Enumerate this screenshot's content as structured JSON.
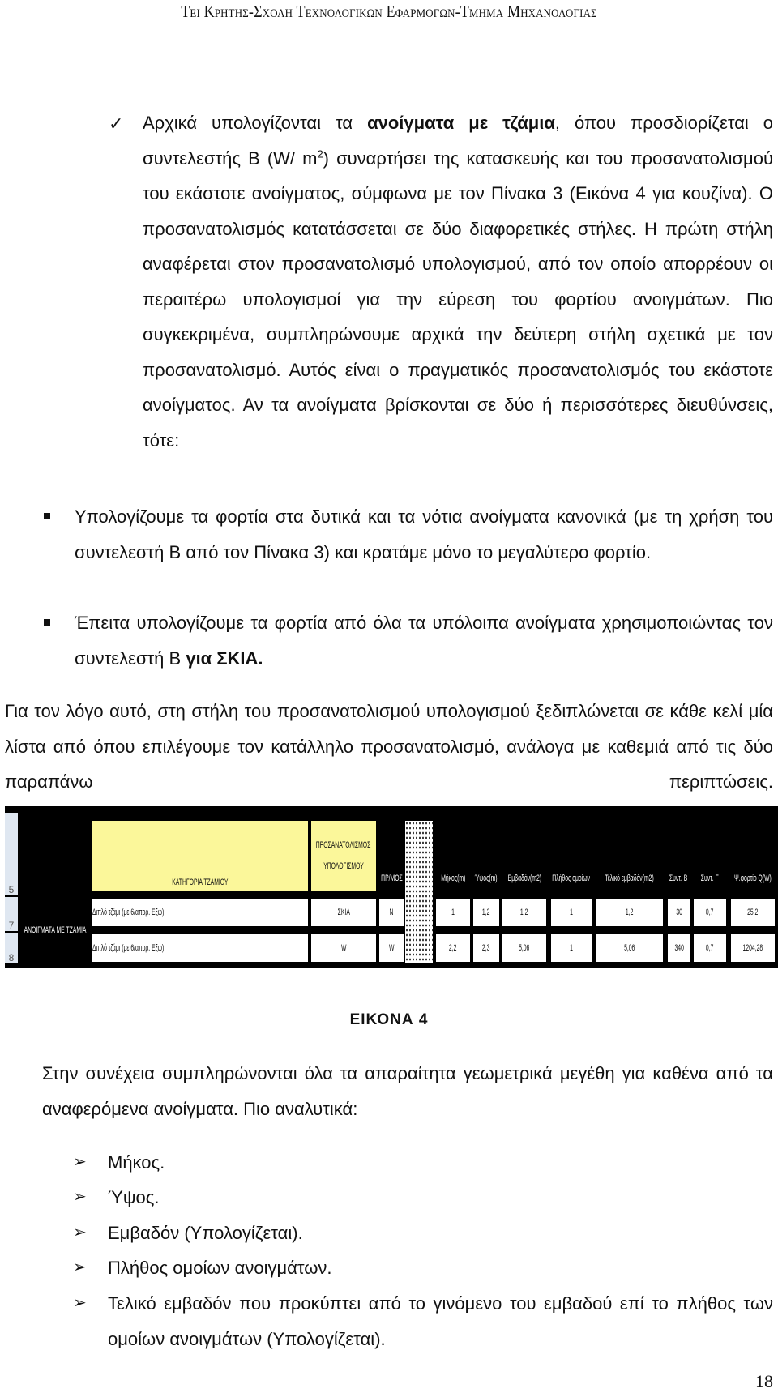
{
  "header": {
    "title": "Τει Κρητης-Σχολη Τεχνολογικων Εφαρμογων-Τμημα Μηχανολογιας"
  },
  "check_item": {
    "icon": "check-icon",
    "lead": "Αρχικά υπολογίζονται τα ",
    "bold": "ανοίγματα με τζάμια",
    "rest1": ", όπου προσδιορίζεται ο συντελεστής Β (W/ m",
    "sup": "2",
    "rest2": ") συναρτήσει της κατασκευής και του προσανατολισμού του εκάστοτε ανοίγματος, σύμφωνα με τον Πίνακα 3 (Εικόνα 4 για κουζίνα). Ο προσανατολισμός κατατάσσεται σε δύο διαφορετικές στήλες. Η πρώτη στήλη αναφέρεται στον προσανατολισμό υπολογισμού, από τον οποίο απορρέουν οι περαιτέρω υπολογισμοί για την εύρεση του φορτίου ανοιγμάτων. Πιο συγκεκριμένα, συμπληρώνουμε αρχικά την δεύτερη στήλη σχετικά με τον προσανατολισμό. Αυτός είναι ο πραγματικός προσανατολισμός του εκάστοτε ανοίγματος. Αν τα ανοίγματα βρίσκονται σε δύο ή περισσότερες διευθύνσεις, τότε:"
  },
  "square_items": [
    {
      "icon": "square-bullet-icon",
      "text": "Υπολογίζουμε τα φορτία στα δυτικά και τα νότια ανοίγματα κανονικά (με τη χρήση του συντελεστή Β από τον Πίνακα 3) και κρατάμε μόνο το μεγαλύτερο φορτίο."
    },
    {
      "icon": "square-bullet-icon",
      "text": "Έπειτα υπολογίζουμε τα φορτία από όλα τα υπόλοιπα ανοίγματα χρησιμοποιώντας τον συντελεστή Β ",
      "bold": "για ΣΚΙΑ."
    }
  ],
  "paragraph1": "Για τον λόγο αυτό, στη στήλη του προσανατολισμού υπολογισμού ξεδιπλώνεται σε κάθε κελί μία λίστα από όπου επιλέγουμε τον κατάλληλο προσανατολισμό, ανάλογα με καθεμιά από τις δύο παραπάνω περιπτώσεις.",
  "figure": {
    "row_numbers": [
      "5",
      "7",
      "8"
    ],
    "group_label": "ΑΝΟΙΓΜΑΤΑ ΜΕ ΤΖΑΜΙΑ",
    "headers": {
      "category": "ΚΑΤΗΓΟΡΙΑ ΤΖΑΜΙΟΥ",
      "calc_orientation_1": "ΠΡΟΣΑΝΑΤΟΛΙΣΜΟΣ",
      "calc_orientation_2": "ΥΠΟΛΟΓΙΣΜΟΥ",
      "orientation": "ΠΡ/ΜΟΣ",
      "length": "Μήκος(m)",
      "height": "Ύψος(m)",
      "area": "Εμβαδόν(m2)",
      "count": "Πλήθος ομοίων",
      "final_area": "Τελικό εμβαδόν(m2)",
      "coef_b": "Συντ. Β",
      "coef_f": "Συντ. F",
      "load": "Ψ.φορτίο Q(W)"
    },
    "rows": [
      {
        "category": "Διπλό τζάμι (με 6/απορ. Εξω)",
        "calc_orientation": "ΣΚΙΑ",
        "orientation": "N",
        "length": "1",
        "height": "1,2",
        "area": "1,2",
        "count": "1",
        "final_area": "1,2",
        "coef_b": "30",
        "coef_f": "0,7",
        "load": "25,2"
      },
      {
        "category": "Διπλό τζάμι (με 6/απορ. Εξω)",
        "calc_orientation": "W",
        "orientation": "W",
        "length": "2,2",
        "height": "2,3",
        "area": "5,06",
        "count": "1",
        "final_area": "5,06",
        "coef_b": "340",
        "coef_f": "0,7",
        "load": "1204,28"
      }
    ]
  },
  "caption": "ΕΙΚΟΝΑ 4",
  "paragraph2": "Στην συνέχεια συμπληρώνονται όλα τα απαραίτητα γεωμετρικά μεγέθη για καθένα από τα αναφερόμενα ανοίγματα. Πιο αναλυτικά:",
  "arrow_items": [
    {
      "icon": "arrow-bullet-icon",
      "text": "Μήκος."
    },
    {
      "icon": "arrow-bullet-icon",
      "text": "Ύψος."
    },
    {
      "icon": "arrow-bullet-icon",
      "text": "Εμβαδόν (Υπολογίζεται)."
    },
    {
      "icon": "arrow-bullet-icon",
      "text": "Πλήθος ομοίων ανοιγμάτων."
    },
    {
      "icon": "arrow-bullet-icon",
      "text": "Τελικό εμβαδόν που προκύπτει από το γινόμενο του εμβαδού επί το πλήθος των ομοίων ανοιγμάτων (Υπολογίζεται)."
    }
  ],
  "page_number": "18"
}
